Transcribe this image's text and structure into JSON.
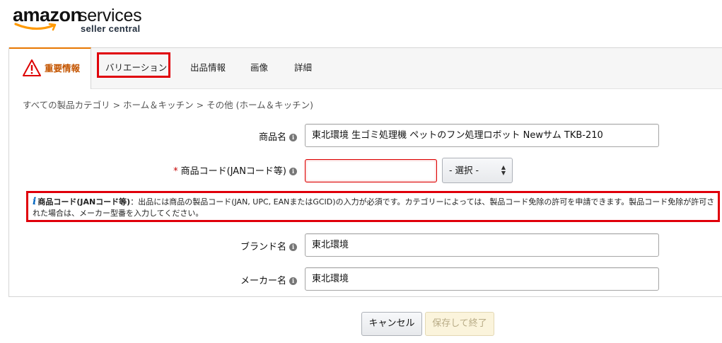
{
  "logo": {
    "amazon": "amazon",
    "services": "services",
    "subtitle": "seller central"
  },
  "tabs": [
    {
      "label": "重要情報",
      "active": true
    },
    {
      "label": "バリエーション"
    },
    {
      "label": "出品情報"
    },
    {
      "label": "画像"
    },
    {
      "label": "詳細"
    }
  ],
  "breadcrumb": "すべての製品カテゴリ > ホーム＆キッチン > その他 (ホーム＆キッチン)",
  "fields": {
    "product_name": {
      "label": "商品名",
      "value": "東北環境 生ゴミ処理機 ペットのフン処理ロボット Newサム TKB-210"
    },
    "product_code": {
      "required": "*",
      "label": "商品コード(JANコード等)",
      "value": "",
      "select_value": "- 選択 -"
    },
    "brand": {
      "label": "ブランド名",
      "value": "東北環境"
    },
    "manufacturer": {
      "label": "メーカー名",
      "value": "東北環境"
    }
  },
  "note": {
    "icon": "i",
    "title": "商品コード(JANコード等)",
    "text": "：出品には商品の製品コード(JAN, UPC, EANまたはGCID)の入力が必須です。カテゴリーによっては、製品コード免除の許可を申請できます。製品コード免除が許可された場合は、メーカー型番を入力してください。"
  },
  "buttons": {
    "cancel": "キャンセル",
    "save": "保存して終了"
  },
  "colors": {
    "highlight": "#e0000a",
    "active_tab_text": "#c45500",
    "info_link": "#0066c0"
  }
}
